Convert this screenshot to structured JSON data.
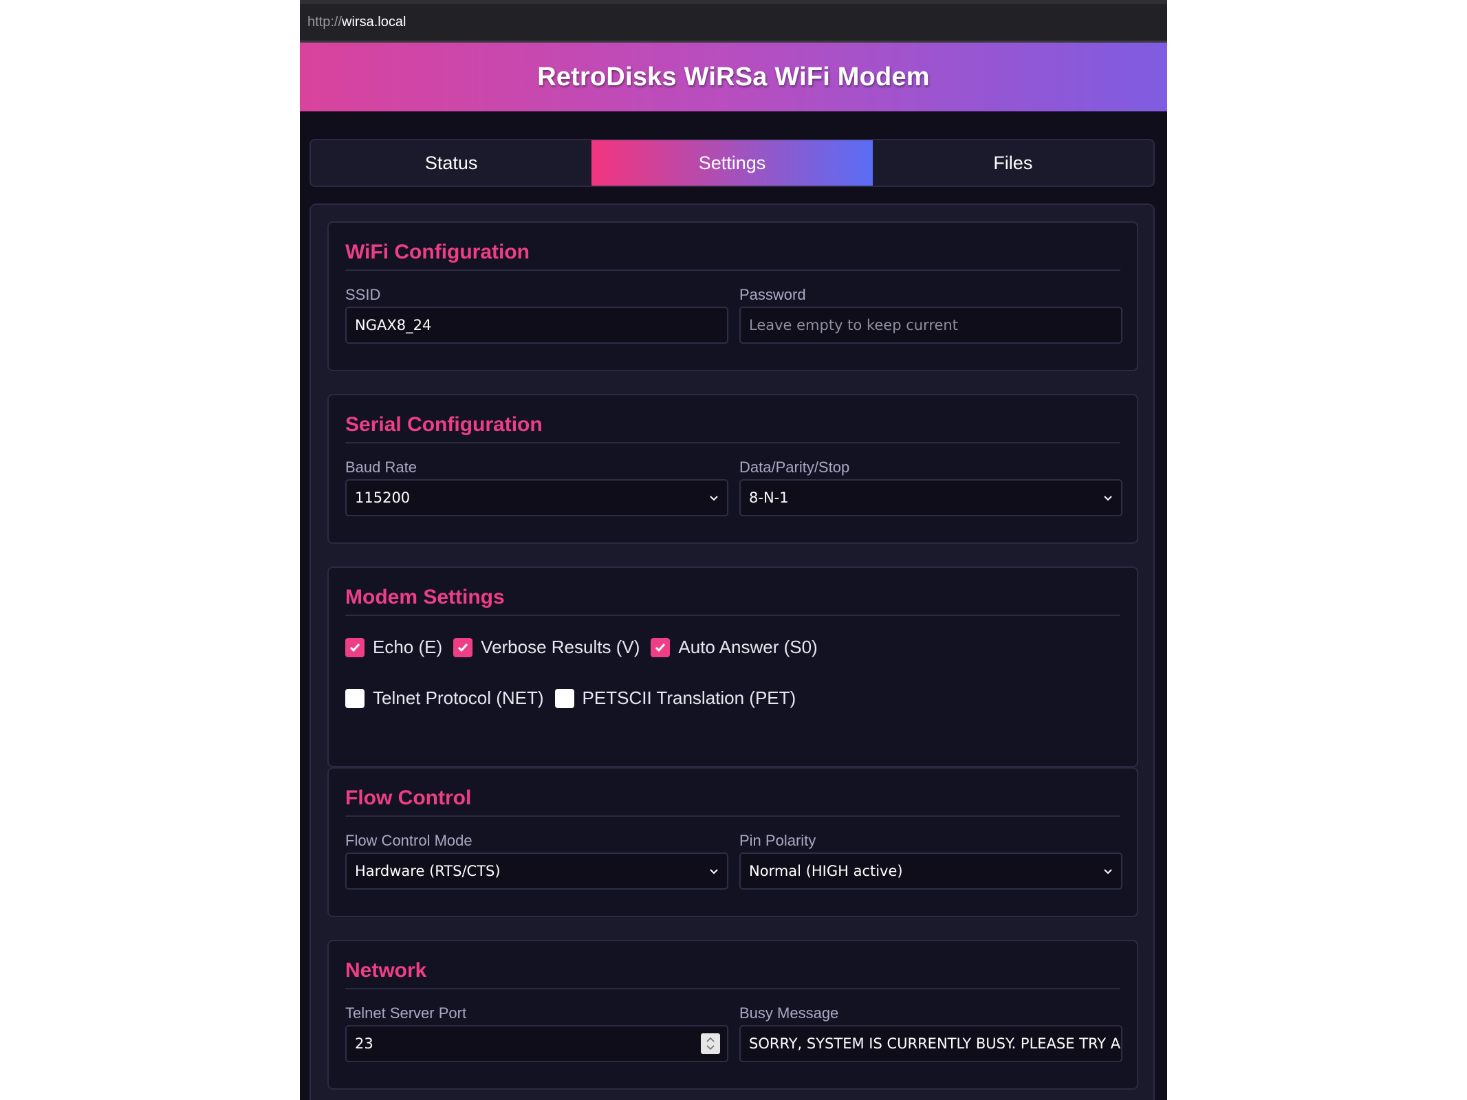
{
  "browser": {
    "url_protocol": "http://",
    "url_host": "wirsa.local"
  },
  "header": {
    "title": "RetroDisks WiRSa WiFi Modem"
  },
  "tabs": [
    {
      "label": "Status",
      "active": false
    },
    {
      "label": "Settings",
      "active": true
    },
    {
      "label": "Files",
      "active": false
    }
  ],
  "wifi": {
    "heading": "WiFi Configuration",
    "ssid_label": "SSID",
    "ssid_value": "NGAX8_24",
    "password_label": "Password",
    "password_placeholder": "Leave empty to keep current"
  },
  "serial": {
    "heading": "Serial Configuration",
    "baud_label": "Baud Rate",
    "baud_value": "115200",
    "dps_label": "Data/Parity/Stop",
    "dps_value": "8-N-1"
  },
  "modem": {
    "heading": "Modem Settings",
    "options": [
      {
        "label": "Echo (E)",
        "checked": true
      },
      {
        "label": "Verbose Results (V)",
        "checked": true
      },
      {
        "label": "Auto Answer (S0)",
        "checked": true
      },
      {
        "label": "Telnet Protocol (NET)",
        "checked": false
      },
      {
        "label": "PETSCII Translation (PET)",
        "checked": false
      }
    ]
  },
  "flow": {
    "heading": "Flow Control",
    "mode_label": "Flow Control Mode",
    "mode_value": "Hardware (RTS/CTS)",
    "polarity_label": "Pin Polarity",
    "polarity_value": "Normal (HIGH active)"
  },
  "network": {
    "heading": "Network",
    "port_label": "Telnet Server Port",
    "port_value": "23",
    "busy_label": "Busy Message",
    "busy_value": "SORRY, SYSTEM IS CURRENTLY BUSY. PLEASE TRY AGAI"
  },
  "colors": {
    "accent": "#ee3f86",
    "background": "#0f0e1a",
    "panel": "#1b1a2c"
  }
}
